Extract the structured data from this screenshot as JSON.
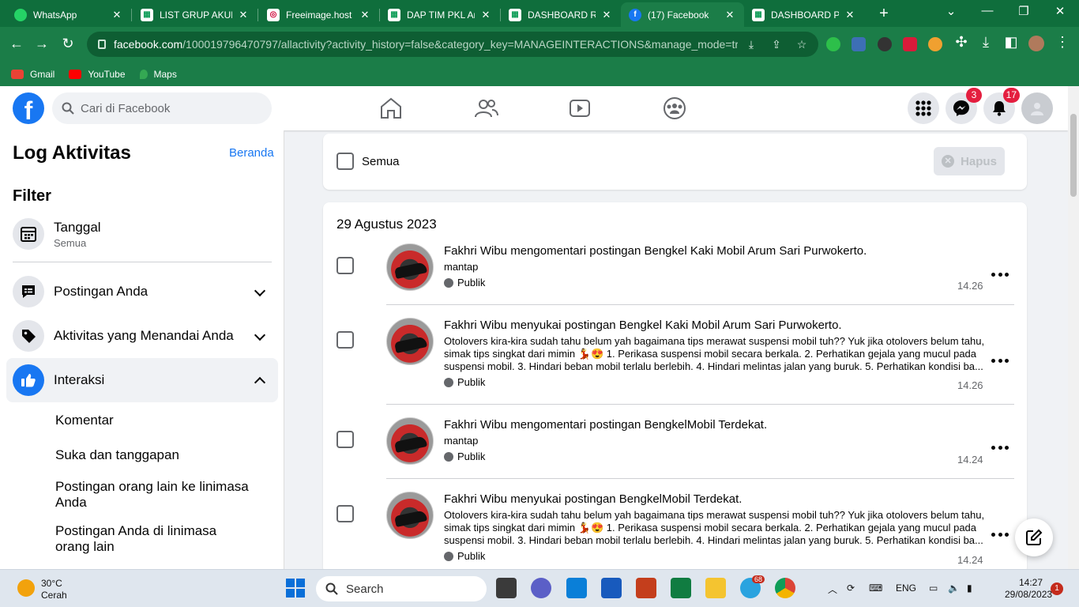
{
  "browser": {
    "tabs": [
      {
        "title": "WhatsApp",
        "icon": "whatsapp-icon",
        "color": "#25d366"
      },
      {
        "title": "LIST GRUP AKUN",
        "icon": "sheets-icon",
        "color": "#0f9d58"
      },
      {
        "title": "Freeimage.host –",
        "icon": "freeimage-icon",
        "color": "#e8eaed"
      },
      {
        "title": "DAP TIM PKL Aru",
        "icon": "sheets-icon",
        "color": "#0f9d58"
      },
      {
        "title": "DASHBOARD RU",
        "icon": "sheets-icon",
        "color": "#0f9d58"
      },
      {
        "title": "(17) Facebook",
        "icon": "facebook-icon",
        "color": "#1877f2",
        "active": true
      },
      {
        "title": "DASHBOARD PRA",
        "icon": "sheets-icon",
        "color": "#0f9d58"
      }
    ],
    "url_main": "facebook.com",
    "url_rest": "/100019796470797/allactivity?activity_history=false&category_key=MANAGEINTERACTIONS&manage_mode=tr...",
    "bookmarks": [
      {
        "label": "Gmail",
        "icon": "gmail-icon",
        "color": "#ea4335"
      },
      {
        "label": "YouTube",
        "icon": "youtube-icon",
        "color": "#ff0000"
      },
      {
        "label": "Maps",
        "icon": "maps-icon",
        "color": "#34a853"
      }
    ]
  },
  "fb": {
    "logo": "f",
    "search_placeholder": "Cari di Facebook",
    "messenger_badge": "3",
    "notif_badge": "17",
    "accent": "#1877f2"
  },
  "left": {
    "title": "Log Aktivitas",
    "home_link": "Beranda",
    "filter_heading": "Filter",
    "date_label": "Tanggal",
    "date_value": "Semua",
    "sections": [
      {
        "label": "Postingan Anda",
        "icon": "post-icon"
      },
      {
        "label": "Aktivitas yang Menandai Anda",
        "icon": "tag-icon"
      },
      {
        "label": "Interaksi",
        "icon": "like-icon"
      }
    ],
    "sub_items": [
      "Komentar",
      "Suka dan tanggapan",
      "Postingan orang lain ke linimasa Anda",
      "Postingan Anda di linimasa orang lain"
    ]
  },
  "main": {
    "select_all_label": "Semua",
    "delete_label": "Hapus",
    "date_heading": "29 Agustus 2023",
    "entries": [
      {
        "actor": "Fakhri Wibu",
        "verb": "mengomentari",
        "object": "postingan Bengkel Kaki Mobil Arum Sari Purwokerto",
        "text": "mantap",
        "audience": "Publik",
        "time": "14.26"
      },
      {
        "actor": "Fakhri Wibu",
        "verb": "menyukai",
        "object": "postingan Bengkel Kaki Mobil Arum Sari Purwokerto",
        "text": "Otolovers kira-kira sudah tahu belum yah bagaimana tips merawat suspensi mobil tuh?? Yuk jika otolovers belum tahu, simak tips singkat dari mimin 💃😍 1. Perikasa suspensi mobil secara berkala. 2. Perhatikan gejala yang mucul pada suspensi mobil. 3. Hindari beban mobil terlalu berlebih. 4. Hindari melintas jalan yang buruk. 5. Perhatikan kondisi ba...",
        "audience": "Publik",
        "time": "14.26"
      },
      {
        "actor": "Fakhri Wibu",
        "verb": "mengomentari",
        "object": "postingan BengkelMobil Terdekat",
        "text": "mantap",
        "audience": "Publik",
        "time": "14.24"
      },
      {
        "actor": "Fakhri Wibu",
        "verb": "menyukai",
        "object": "postingan BengkelMobil Terdekat",
        "text": "Otolovers kira-kira sudah tahu belum yah bagaimana tips merawat suspensi mobil tuh?? Yuk jika otolovers belum tahu, simak tips singkat dari mimin 💃😍 1. Perikasa suspensi mobil secara berkala. 2. Perhatikan gejala yang mucul pada suspensi mobil. 3. Hindari beban mobil terlalu berlebih. 4. Hindari melintas jalan yang buruk. 5. Perhatikan kondisi ba...",
        "audience": "Publik",
        "time": "14.24"
      }
    ]
  },
  "taskbar": {
    "temp": "30°C",
    "weather": "Cerah",
    "search_label": "Search",
    "lang": "ENG",
    "time": "14:27",
    "date": "29/08/2023",
    "notif_count": "1",
    "telegram_badge": "68"
  }
}
